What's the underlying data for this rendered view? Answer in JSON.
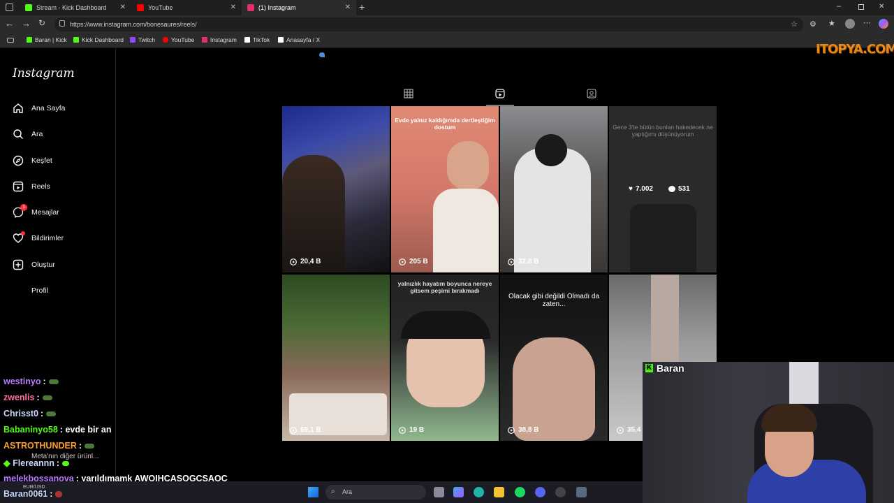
{
  "browser": {
    "tabs": [
      {
        "label": "Stream - Kick Dashboard",
        "color": "#53fc18"
      },
      {
        "label": "YouTube",
        "color": "#ff0000"
      },
      {
        "label": "(1) Instagram",
        "color": "#e1306c"
      }
    ],
    "url": "https://www.instagram.com/bonesaures/reels/",
    "bookmarks": [
      {
        "label": "Baran | Kick",
        "color": "#53fc18"
      },
      {
        "label": "Kick Dashboard",
        "color": "#53fc18"
      },
      {
        "label": "Twitch",
        "color": "#9146ff"
      },
      {
        "label": "YouTube",
        "color": "#ff0000"
      },
      {
        "label": "Instagram",
        "color": "#e1306c"
      },
      {
        "label": "TikTok",
        "color": "#ffffff"
      },
      {
        "label": "Anasayfa / X",
        "color": "#ffffff"
      }
    ]
  },
  "watermark": "ITOPYA.COM",
  "instagram": {
    "logo": "Instagram",
    "nav": [
      {
        "label": "Ana Sayfa",
        "icon": "home-icon"
      },
      {
        "label": "Ara",
        "icon": "search-icon"
      },
      {
        "label": "Keşfet",
        "icon": "compass-icon"
      },
      {
        "label": "Reels",
        "icon": "reels-icon"
      },
      {
        "label": "Mesajlar",
        "icon": "messenger-icon",
        "badge": "1"
      },
      {
        "label": "Bildirimler",
        "icon": "heart-icon"
      },
      {
        "label": "Oluştur",
        "icon": "plus-icon"
      },
      {
        "label": "Profil",
        "icon": "avatar-icon"
      }
    ],
    "more_label": "Meta'nın diğer ürünl...",
    "reels": [
      {
        "views": "20,4 B",
        "caption": ""
      },
      {
        "views": "205 B",
        "caption": "Evde yalnız kaldığımda dertleştiğim dostum"
      },
      {
        "views": "32,8 B",
        "caption": ""
      },
      {
        "views": "",
        "caption": "Gece 3'te bütün bunları hakedecek ne yaptığımı düşünüyorum",
        "likes": "7.002",
        "comments": "531"
      },
      {
        "views": "69,1 B",
        "caption": ""
      },
      {
        "views": "19 B",
        "caption": "yalnızlık hayatım boyunca nereye gitsem peşimi bırakmadı"
      },
      {
        "views": "38,8 B",
        "caption": "Olacak gibi değildi Olmadı da zaten..."
      },
      {
        "views": "35,4",
        "caption": ""
      }
    ]
  },
  "chat": [
    {
      "user": "westinyo",
      "color": "#b57cff",
      "msg": ""
    },
    {
      "user": "zwenlis",
      "color": "#ff6fa8",
      "msg": ""
    },
    {
      "user": "Chrisst0",
      "color": "#c9d8ff",
      "msg": ""
    },
    {
      "user": "Babaninyo58",
      "color": "#53fc18",
      "msg": "evde bir an"
    },
    {
      "user": "ASTROTHUNDER",
      "color": "#ff9d2e",
      "msg": ""
    },
    {
      "user": "Flereannn",
      "color": "#c9d8ff",
      "msg": ""
    },
    {
      "user": "melekbossanova",
      "color": "#b57cff",
      "msg": "yarıldımamk AWOIHCASOGCSAOC"
    },
    {
      "user": "Baran0061",
      "color": "#c9d8ff",
      "msg": ""
    }
  ],
  "taskbar": {
    "search_placeholder": "Ara",
    "ticker": "EUR/USD"
  },
  "cam": {
    "name": "Baran"
  }
}
